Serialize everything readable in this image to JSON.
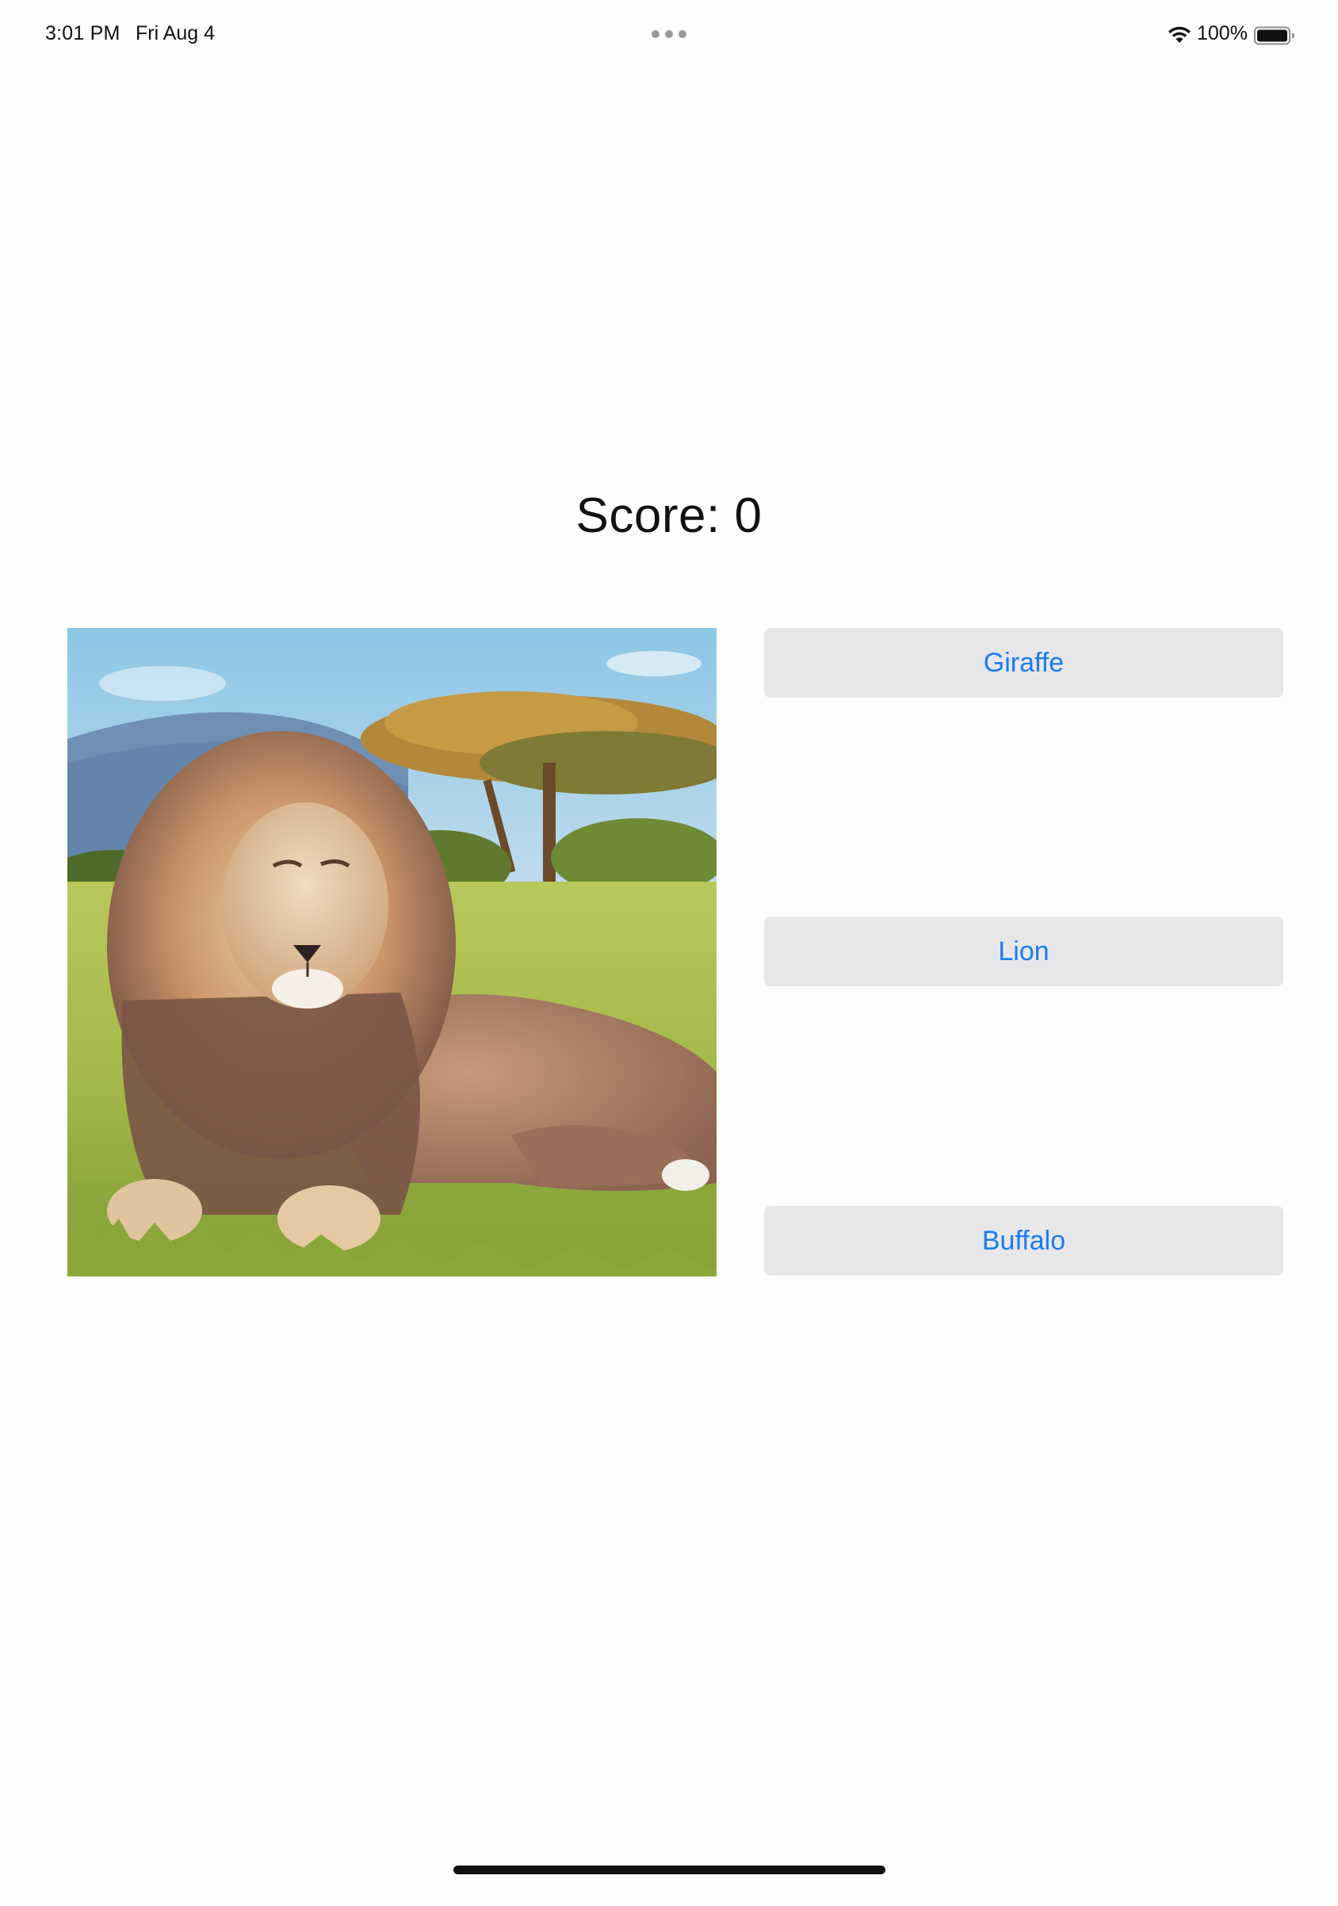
{
  "status_bar": {
    "time": "3:01 PM",
    "date": "Fri Aug 4",
    "battery_percent": "100%",
    "battery_level": 1.0,
    "wifi_icon": "wifi-icon",
    "battery_icon": "battery-icon",
    "multitask_icon": "multitask-dots-icon"
  },
  "game": {
    "score_text": "Score: 0",
    "picture": {
      "subject": "lion",
      "icon": "lion-photo"
    },
    "answers": [
      {
        "label": "Giraffe"
      },
      {
        "label": "Lion"
      },
      {
        "label": "Buffalo"
      }
    ]
  },
  "colors": {
    "background": "#fdfdfd",
    "button_bg": "#e7e7ea",
    "button_text": "#1a7cf0",
    "text": "#111111"
  }
}
